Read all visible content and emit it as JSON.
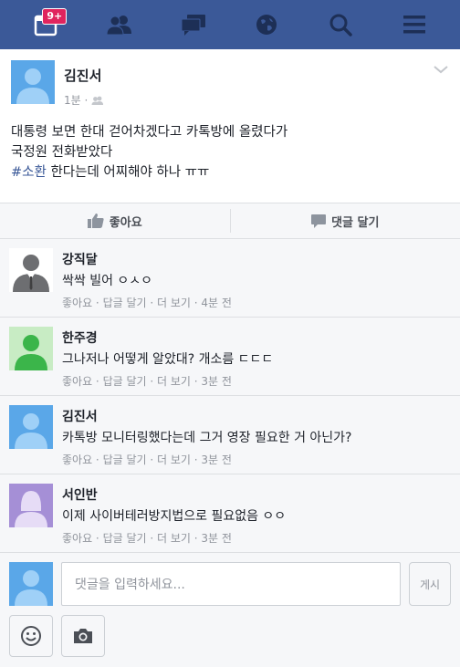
{
  "topbar": {
    "badge": "9+",
    "icons": [
      "notifications-icon",
      "friends-icon",
      "messages-icon",
      "globe-icon",
      "search-icon",
      "menu-icon"
    ]
  },
  "post": {
    "author": "김진서",
    "time": "1분 ·",
    "line1": "대통령 보면 한대 걷어차겠다고 카톡방에 올렸다가",
    "line2": "국정원 전화받았다",
    "hashtag": "#소환",
    "line3_rest": " 한다는데 어찌해야 하나 ㅠㅠ"
  },
  "actions": {
    "like": "좋아요",
    "comment": "댓글 달기"
  },
  "comments": [
    {
      "name": "강직달",
      "text": "싹싹 빌어 ㅇㅅㅇ",
      "meta": "좋아요 · 답글 달기 · 더 보기 · 4분 전"
    },
    {
      "name": "한주경",
      "text": "그나저나 어떻게 알았대? 개소름 ㄷㄷㄷ",
      "meta": "좋아요 · 답글 달기 · 더 보기 · 3분 전"
    },
    {
      "name": "김진서",
      "text": "카톡방 모니터링했다는데 그거 영장 필요한 거 아닌가?",
      "meta": "좋아요 · 답글 달기 · 더 보기 · 3분 전"
    },
    {
      "name": "서인반",
      "text": "이제 사이버테러방지법으로 필요없음 ㅇㅇ",
      "meta": "좋아요 · 답글 달기 · 더 보기 · 3분 전"
    }
  ],
  "composer": {
    "placeholder": "댓글을 입력하세요...",
    "post_label": "게시"
  },
  "colors": {
    "brand": "#3b5998",
    "hashtag": "#3b5998",
    "badge": "#e0245e"
  }
}
